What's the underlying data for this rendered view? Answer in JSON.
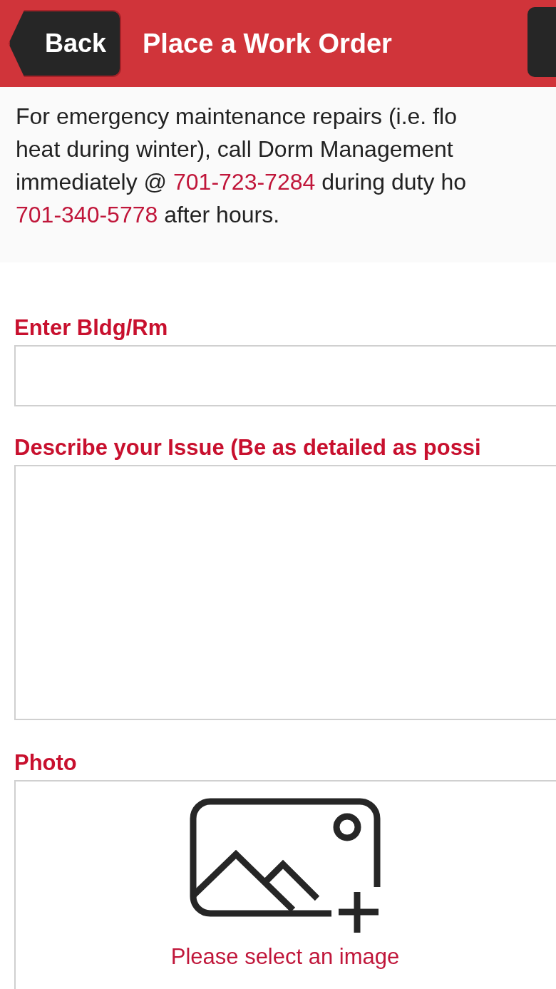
{
  "header": {
    "back_button": "Back",
    "title": "Place a Work Order"
  },
  "notice": {
    "lines": [
      [
        {
          "kind": "text",
          "text": "For emergency maintenance repairs (i.e. flo"
        }
      ],
      [
        {
          "kind": "text",
          "text": "heat during winter), call Dorm Management"
        }
      ],
      [
        {
          "kind": "text",
          "text": "immediately @ "
        },
        {
          "kind": "phone",
          "text": "701-723-7284"
        },
        {
          "kind": "text",
          "text": " during duty ho"
        }
      ],
      [
        {
          "kind": "phone",
          "text": "701-340-5778"
        },
        {
          "kind": "text",
          "text": " after hours."
        }
      ]
    ]
  },
  "fields": [
    {
      "kind": "input",
      "label": "Enter Bldg/Rm"
    },
    {
      "kind": "textarea",
      "label": "Describe your Issue (Be as detailed as possi"
    },
    {
      "kind": "photo",
      "label": "Photo",
      "hint": "Please select an image"
    }
  ]
}
